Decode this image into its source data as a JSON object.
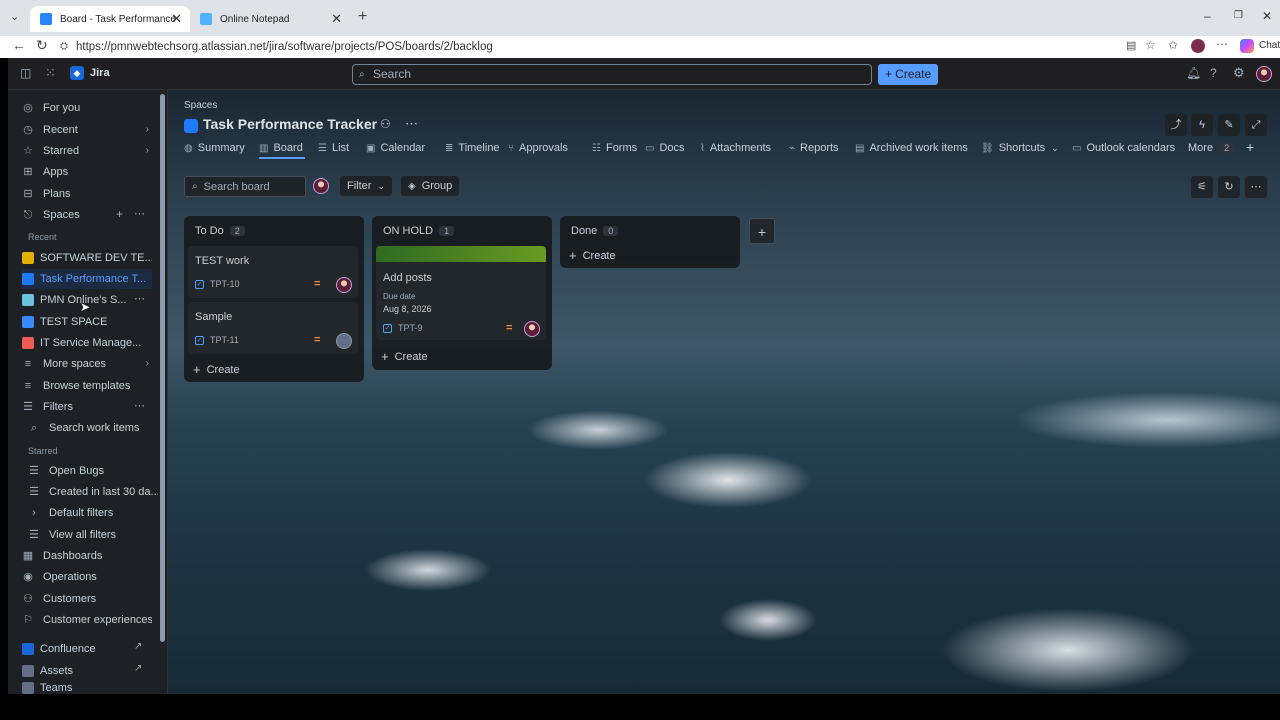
{
  "browser": {
    "tabs": [
      {
        "title": "Board - Task Performance Tracker",
        "color": "#2684ff"
      },
      {
        "title": "Online Notepad",
        "color": "#4fb3ff"
      }
    ],
    "url": "https://pmnwebtechsorg.atlassian.net/jira/software/projects/POS/boards/2/backlog",
    "chat_label": "Chat"
  },
  "topnav": {
    "app_name": "Jira",
    "search_placeholder": "Search",
    "create_label": "Create"
  },
  "sidebar": {
    "for_you": "For you",
    "recent": "Recent",
    "starred": "Starred",
    "apps": "Apps",
    "plans": "Plans",
    "spaces": "Spaces",
    "recent_header": "Recent",
    "spaces_list": [
      {
        "label": "SOFTWARE DEV TE...",
        "color": "#e2b203"
      },
      {
        "label": "Task Performance T...",
        "color": "#1d7afc"
      },
      {
        "label": "PMN Online's S...",
        "color": "#6cc3e0"
      },
      {
        "label": "TEST SPACE",
        "color": "#388bff"
      },
      {
        "label": "IT Service Manage...",
        "color": "#f15b50"
      }
    ],
    "more_spaces": "More spaces",
    "browse_templates": "Browse templates",
    "filters": "Filters",
    "search_work_items": "Search work items",
    "starred_header": "Starred",
    "open_bugs": "Open Bugs",
    "created_last_30": "Created in last 30 da...",
    "default_filters": "Default filters",
    "view_all_filters": "View all filters",
    "dashboards": "Dashboards",
    "operations": "Operations",
    "customers": "Customers",
    "customer_experiences": "Customer experiences",
    "confluence": "Confluence",
    "assets": "Assets",
    "teams": "Teams"
  },
  "header": {
    "breadcrumb": "Spaces",
    "title": "Task Performance Tracker"
  },
  "tabs": [
    {
      "label": "Summary",
      "icon": "globe-icon"
    },
    {
      "label": "Board",
      "icon": "board-icon"
    },
    {
      "label": "List",
      "icon": "list-icon"
    },
    {
      "label": "Calendar",
      "icon": "calendar-icon"
    },
    {
      "label": "Timeline",
      "icon": "timeline-icon"
    },
    {
      "label": "Approvals",
      "icon": "approvals-icon"
    },
    {
      "label": "Forms",
      "icon": "forms-icon"
    },
    {
      "label": "Docs",
      "icon": "docs-icon"
    },
    {
      "label": "Attachments",
      "icon": "paperclip-icon"
    },
    {
      "label": "Reports",
      "icon": "reports-icon"
    },
    {
      "label": "Archived work items",
      "icon": "archive-icon"
    },
    {
      "label": "Shortcuts",
      "icon": "link-icon"
    },
    {
      "label": "Outlook calendars",
      "icon": "outlook-icon"
    },
    {
      "label": "More",
      "icon": ""
    }
  ],
  "more_count": "2",
  "toolbar": {
    "search_placeholder": "Search board",
    "filter_label": "Filter",
    "group_label": "Group"
  },
  "columns": [
    {
      "name": "To Do",
      "count": "2"
    },
    {
      "name": "ON HOLD",
      "count": "1"
    },
    {
      "name": "Done",
      "count": "0"
    }
  ],
  "cards": {
    "test_work": {
      "title": "TEST work",
      "key": "TPT-10"
    },
    "sample": {
      "title": "Sample",
      "key": "TPT-11"
    },
    "add_posts": {
      "title": "Add posts",
      "due_label": "Due date",
      "due_value": "Aug 8, 2026",
      "key": "TPT-9"
    }
  },
  "create_label": "Create",
  "colors": {
    "accent": "#579dff",
    "on_hold_bar": "#5b7f24",
    "priority": "#f38a3f"
  }
}
